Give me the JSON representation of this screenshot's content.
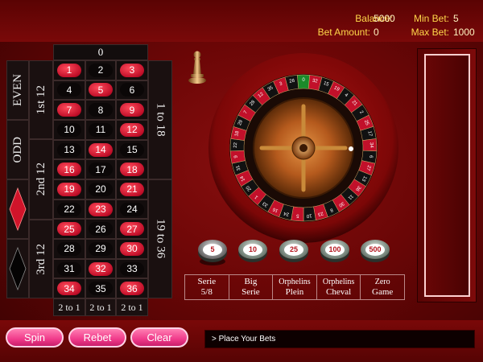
{
  "header": {
    "balance_label": "Balance:",
    "balance_value": "5000",
    "bet_amount_label": "Bet Amount:",
    "bet_amount_value": "0",
    "min_bet_label": "Min Bet:",
    "min_bet_value": "5",
    "max_bet_label": "Max Bet:",
    "max_bet_value": "1000"
  },
  "board": {
    "zero": "0",
    "rows": [
      [
        {
          "n": "1",
          "c": "red"
        },
        {
          "n": "2",
          "c": "black"
        },
        {
          "n": "3",
          "c": "red"
        }
      ],
      [
        {
          "n": "4",
          "c": "black"
        },
        {
          "n": "5",
          "c": "red"
        },
        {
          "n": "6",
          "c": "black"
        }
      ],
      [
        {
          "n": "7",
          "c": "red"
        },
        {
          "n": "8",
          "c": "black"
        },
        {
          "n": "9",
          "c": "red"
        }
      ],
      [
        {
          "n": "10",
          "c": "black"
        },
        {
          "n": "11",
          "c": "black"
        },
        {
          "n": "12",
          "c": "red"
        }
      ],
      [
        {
          "n": "13",
          "c": "black"
        },
        {
          "n": "14",
          "c": "red"
        },
        {
          "n": "15",
          "c": "black"
        }
      ],
      [
        {
          "n": "16",
          "c": "red"
        },
        {
          "n": "17",
          "c": "black"
        },
        {
          "n": "18",
          "c": "red"
        }
      ],
      [
        {
          "n": "19",
          "c": "red"
        },
        {
          "n": "20",
          "c": "black"
        },
        {
          "n": "21",
          "c": "red"
        }
      ],
      [
        {
          "n": "22",
          "c": "black"
        },
        {
          "n": "23",
          "c": "red"
        },
        {
          "n": "24",
          "c": "black"
        }
      ],
      [
        {
          "n": "25",
          "c": "red"
        },
        {
          "n": "26",
          "c": "black"
        },
        {
          "n": "27",
          "c": "red"
        }
      ],
      [
        {
          "n": "28",
          "c": "black"
        },
        {
          "n": "29",
          "c": "black"
        },
        {
          "n": "30",
          "c": "red"
        }
      ],
      [
        {
          "n": "31",
          "c": "black"
        },
        {
          "n": "32",
          "c": "red"
        },
        {
          "n": "33",
          "c": "black"
        }
      ],
      [
        {
          "n": "34",
          "c": "red"
        },
        {
          "n": "35",
          "c": "black"
        },
        {
          "n": "36",
          "c": "red"
        }
      ]
    ],
    "dozens": [
      "1st 12",
      "2nd 12",
      "3rd 12"
    ],
    "even": "EVEN",
    "odd": "ODD",
    "low": "1 to 18",
    "high": "19 to 36",
    "columns": [
      "2 to 1",
      "2 to 1",
      "2 to 1"
    ]
  },
  "wheel": {
    "numbers": [
      "0",
      "32",
      "15",
      "19",
      "4",
      "21",
      "2",
      "25",
      "17",
      "34",
      "6",
      "27",
      "13",
      "36",
      "11",
      "30",
      "8",
      "23",
      "10",
      "5",
      "24",
      "16",
      "33",
      "1",
      "20",
      "14",
      "31",
      "9",
      "22",
      "18",
      "29",
      "7",
      "28",
      "12",
      "35",
      "3",
      "26"
    ],
    "reds": [
      "1",
      "3",
      "5",
      "7",
      "9",
      "12",
      "14",
      "16",
      "18",
      "19",
      "21",
      "23",
      "25",
      "27",
      "30",
      "32",
      "34",
      "36"
    ]
  },
  "chips": [
    "5",
    "10",
    "25",
    "100",
    "500"
  ],
  "bet_types": [
    {
      "line1": "Serie",
      "line2": "5/8"
    },
    {
      "line1": "Big",
      "line2": "Serie"
    },
    {
      "line1": "Orphelins",
      "line2": "Plein"
    },
    {
      "line1": "Orphelins",
      "line2": "Cheval"
    },
    {
      "line1": "Zero",
      "line2": "Game"
    }
  ],
  "buttons": {
    "spin": "Spin",
    "rebet": "Rebet",
    "clear": "Clear"
  },
  "status": "> Place Your Bets",
  "colors": {
    "red": "#c2102a",
    "black": "#0b0707",
    "accent": "#ffd84a",
    "pink": "#f03a8a"
  }
}
